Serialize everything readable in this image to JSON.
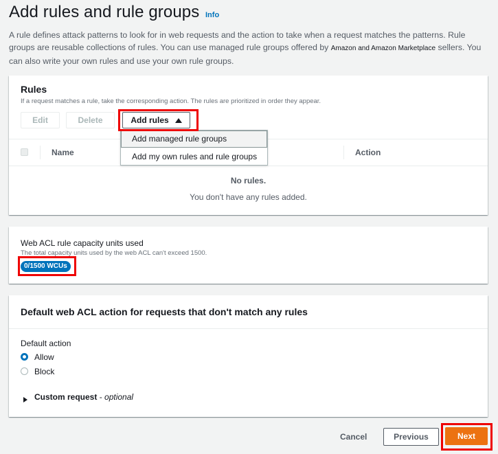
{
  "header": {
    "title": "Add rules and rule groups",
    "info": "Info",
    "desc_before": "A rule defines attack patterns to look for in web requests and the action to take when a request matches the patterns. Rule groups are reusable collections of rules. You can use managed rule groups offered by ",
    "desc_vendor": "Amazon and Amazon Marketplace",
    "desc_after": " sellers. You can also write your own rules and use your own rule groups."
  },
  "rules": {
    "title": "Rules",
    "subtitle": "If a request matches a rule, take the corresponding action. The rules are prioritized in order they appear.",
    "edit_label": "Edit",
    "delete_label": "Delete",
    "add_rules_label": "Add rules",
    "columns": [
      "Name",
      "Action"
    ],
    "empty_title": "No rules.",
    "empty_text": "You don't have any rules added.",
    "menu": [
      "Add managed rule groups",
      "Add my own rules and rule groups"
    ]
  },
  "capacity": {
    "title": "Web ACL rule capacity units used",
    "subtitle": "The total capacity units used by the web ACL can't exceed 1500.",
    "badge": "0/1500 WCUs"
  },
  "default_action": {
    "title": "Default web ACL action for requests that don't match any rules",
    "label": "Default action",
    "options": [
      "Allow",
      "Block"
    ],
    "selected": "Allow",
    "custom_request": "Custom request",
    "optional": "optional"
  },
  "footer": {
    "cancel": "Cancel",
    "previous": "Previous",
    "next": "Next"
  },
  "colors": {
    "accent": "#0073bb",
    "primary": "#ec7211",
    "highlight": "#e00000"
  }
}
